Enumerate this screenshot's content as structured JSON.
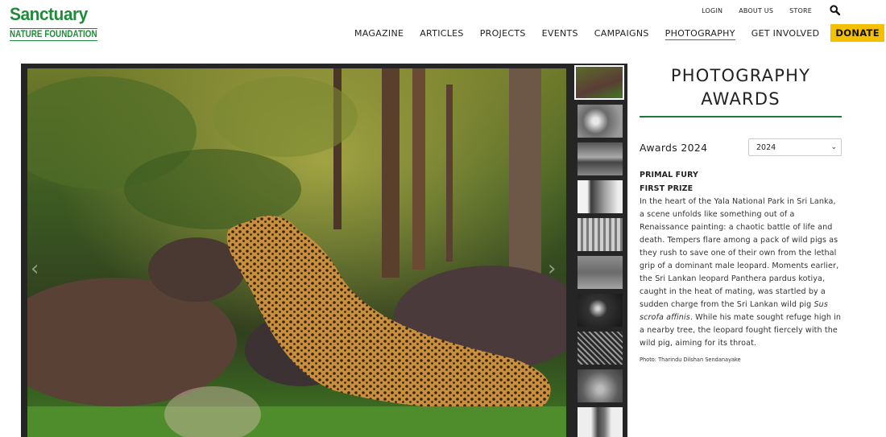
{
  "logo": {
    "main": "Sanctuary",
    "sub": "NATURE FOUNDATION"
  },
  "utility": {
    "login": "LOGIN",
    "about": "ABOUT US",
    "store": "STORE"
  },
  "nav": {
    "items": [
      "MAGAZINE",
      "ARTICLES",
      "PROJECTS",
      "EVENTS",
      "CAMPAIGNS",
      "PHOTOGRAPHY",
      "GET INVOLVED"
    ],
    "active": "PHOTOGRAPHY",
    "donate": "DONATE"
  },
  "gallery": {
    "prev": "‹",
    "next": "›",
    "thumb_count": 10,
    "selected_index": 0
  },
  "panel": {
    "title_line1": "PHOTOGRAPHY",
    "title_line2": "AWARDS",
    "awards_label": "Awards 2024",
    "year_selected": "2024",
    "entry_title": "PRIMAL FURY",
    "entry_prize": "FIRST PRIZE",
    "description_main": "In the heart of the Yala National Park in Sri Lanka, a scene unfolds like something out of a Renaissance painting: a chaotic battle of life and death. Tempers flare among a pack of wild pigs as they rush to save one of their own from the lethal grip of a dominant male leopard. Moments earlier, the Sri Lankan leopard Panthera pardus kotiya, caught in the heat of mating, was startled by a sudden charge from the Sri Lankan wild pig ",
    "description_italic": "Sus scrofa affinis",
    "description_end": ". While his mate sought refuge high in a nearby tree, the leopard fought fiercely with the wild pig, aiming for its throat.",
    "credit": "Photo: Tharindu Dilshan Sendanayake"
  },
  "colors": {
    "brand_green": "#1f8a3a",
    "donate_yellow": "#f5c000",
    "gallery_bg": "#252525"
  }
}
